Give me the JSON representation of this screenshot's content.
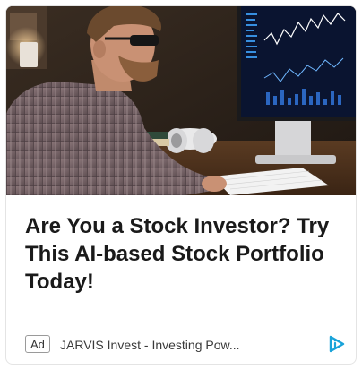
{
  "ad": {
    "headline": "Are You a Stock Investor? Try This AI-based Stock Portfolio Today!",
    "badge": "Ad",
    "source": "JARVIS Invest - Investing Pow...",
    "adchoices_icon": "adchoices-icon"
  },
  "colors": {
    "headline_text": "#1a1a1a",
    "adchoices_accent": "#1aa3d9",
    "border": "#e4e4e4"
  }
}
